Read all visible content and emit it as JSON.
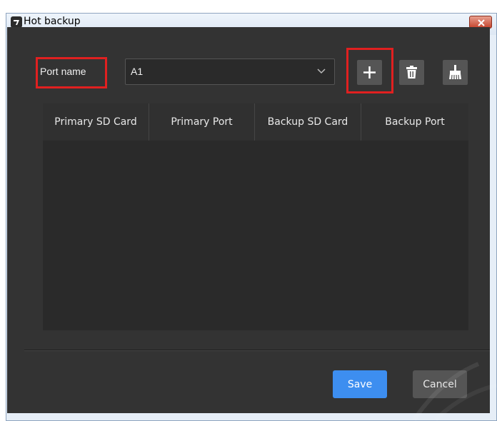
{
  "window": {
    "title": "Hot backup"
  },
  "toolbar": {
    "port_label": "Port name",
    "port_select_value": "A1",
    "add_button_icon": "plus-icon",
    "delete_button_icon": "trash-icon",
    "clear_button_icon": "broom-icon"
  },
  "table": {
    "columns": [
      "Primary SD Card",
      "Primary Port",
      "Backup SD Card",
      "Backup Port"
    ],
    "rows": []
  },
  "footer": {
    "save_label": "Save",
    "cancel_label": "Cancel"
  },
  "colors": {
    "panel_bg": "#333333",
    "highlight_red": "#e02020",
    "save_blue": "#3d8ef0",
    "button_gray": "#555555"
  }
}
